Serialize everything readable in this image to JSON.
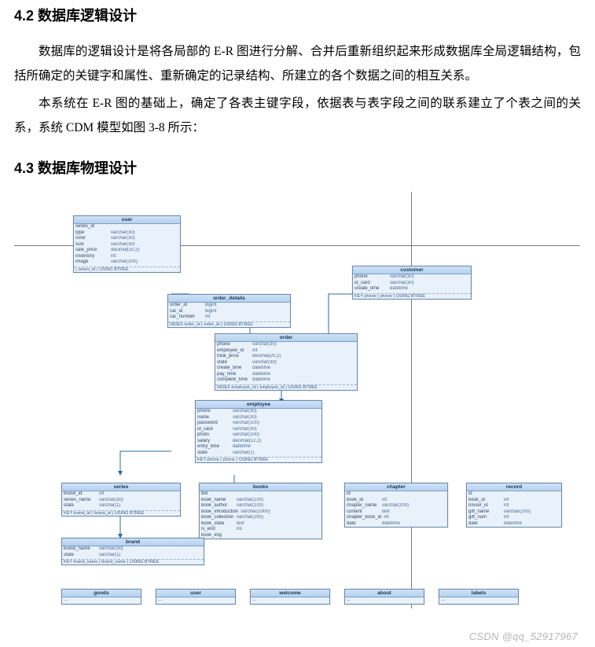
{
  "sections": {
    "h42": "4.2 数据库逻辑设计",
    "p1": "数据库的逻辑设计是将各局部的 E-R 图进行分解、合并后重新组织起来形成数据库全局逻辑结构，包括所确定的关键字和属性、重新确定的记录结构、所建立的各个数据之间的相互关系。",
    "p2": "本系统在 E-R 图的基础上，确定了各表主键字段，依据表与表字段之间的联系建立了个表之间的关系，系统 CDM 模型如图 3-8 所示：",
    "h43": "4.3 数据库物理设计"
  },
  "watermark": "CSDN @qq_52917967",
  "entities": {
    "user": {
      "title": "user",
      "rows": [
        [
          "series_id",
          ""
        ],
        [
          "type",
          "varchar(30)"
        ],
        [
          "color",
          "varchar(30)"
        ],
        [
          "size",
          "varchar(30)"
        ],
        [
          "sale_price",
          "decimal(10,2)"
        ],
        [
          "inventory",
          "int"
        ],
        [
          "image",
          "varchar(200)"
        ],
        [
          "KEY",
          "( series_id ) USING BTREE"
        ]
      ],
      "idx": ""
    },
    "customer": {
      "title": "customer",
      "rows": [
        [
          "phone",
          "varchar(30)"
        ],
        [
          "id_card",
          "varchar(30)"
        ],
        [
          "create_time",
          "datetime"
        ],
        [
          "KEY  phone ( phone ) USING BTREE",
          ""
        ]
      ]
    },
    "order_details": {
      "title": "order_details",
      "rows": [
        [
          "order_id",
          "bigint"
        ],
        [
          "car_id",
          "bigint"
        ],
        [
          "car_number",
          "int"
        ],
        [
          "INDEX  order_id  ( order_id ) USING BTREE",
          ""
        ]
      ]
    },
    "order": {
      "title": "order",
      "rows": [
        [
          "phone",
          "varchar(30)"
        ],
        [
          "employee_id",
          "int"
        ],
        [
          "total_price",
          "decimal(20,2)"
        ],
        [
          "state",
          "varchar(30)"
        ],
        [
          "create_time",
          "datetime"
        ],
        [
          "pay_time",
          "datetime"
        ],
        [
          "complete_time",
          "datetime"
        ],
        [
          "INDEX  employee_id ( employee_id ) USING BTREE",
          ""
        ]
      ]
    },
    "employee": {
      "title": "employee",
      "rows": [
        [
          "phone",
          "varchar(30)"
        ],
        [
          "name",
          "varchar(30)"
        ],
        [
          "password",
          "varchar(100)"
        ],
        [
          "id_card",
          "varchar(30)"
        ],
        [
          "photo",
          "varchar(200)"
        ],
        [
          "salary",
          "decimal(12,2)"
        ],
        [
          "entry_time",
          "datetime"
        ],
        [
          "state",
          "varchar(1)"
        ],
        [
          "KEY  phone ( phone ) USING BTREE",
          ""
        ]
      ]
    },
    "series": {
      "title": "series",
      "rows": [
        [
          "brand_id",
          "int"
        ],
        [
          "series_name",
          "varchar(30)"
        ],
        [
          "state",
          "varchar(1)"
        ],
        [
          "KEY  brand_id ( brand_id ) USING BTREE",
          ""
        ]
      ]
    },
    "books": {
      "title": "books",
      "rows": [
        [
          "bid",
          ""
        ],
        [
          "book_name",
          "varchar(100)"
        ],
        [
          "book_author",
          "varchar(100)"
        ],
        [
          "book_introduction",
          "varchar(2000)"
        ],
        [
          "book_collection",
          "varchar(200)"
        ],
        [
          "book_state",
          "text"
        ],
        [
          "is_end",
          "int"
        ],
        [
          "book_img",
          ""
        ]
      ]
    },
    "chapter": {
      "title": "chapter",
      "rows": [
        [
          "id",
          ""
        ],
        [
          "book_id",
          "int"
        ],
        [
          "chapter_name",
          "varchar(200)"
        ],
        [
          "content",
          "text"
        ],
        [
          "chapter_book_id",
          "int"
        ],
        [
          "date",
          "datetime"
        ]
      ]
    },
    "record": {
      "title": "record",
      "rows": [
        [
          "id",
          ""
        ],
        [
          "book_id",
          "int"
        ],
        [
          "n/user_id",
          "int"
        ],
        [
          "gift_name",
          "varchar(200)"
        ],
        [
          "gift_num",
          "int"
        ],
        [
          "date",
          "datetime"
        ]
      ]
    },
    "brand": {
      "title": "brand",
      "rows": [
        [
          "brand_name",
          "varchar(30)"
        ],
        [
          "state",
          "varchar(1)"
        ],
        [
          "KEY  brand_name ( brand_name ) USING BTREE",
          ""
        ]
      ]
    },
    "stub1": {
      "title": "goods",
      "rows": [
        [
          "...",
          ""
        ]
      ]
    },
    "stub2": {
      "title": "user",
      "rows": [
        [
          "...",
          ""
        ]
      ]
    },
    "stub3": {
      "title": "welcome",
      "rows": [
        [
          "...",
          ""
        ]
      ]
    },
    "stub4": {
      "title": "about",
      "rows": [
        [
          "...",
          ""
        ]
      ]
    },
    "stub5": {
      "title": "labels",
      "rows": [
        [
          "...",
          ""
        ]
      ]
    }
  }
}
